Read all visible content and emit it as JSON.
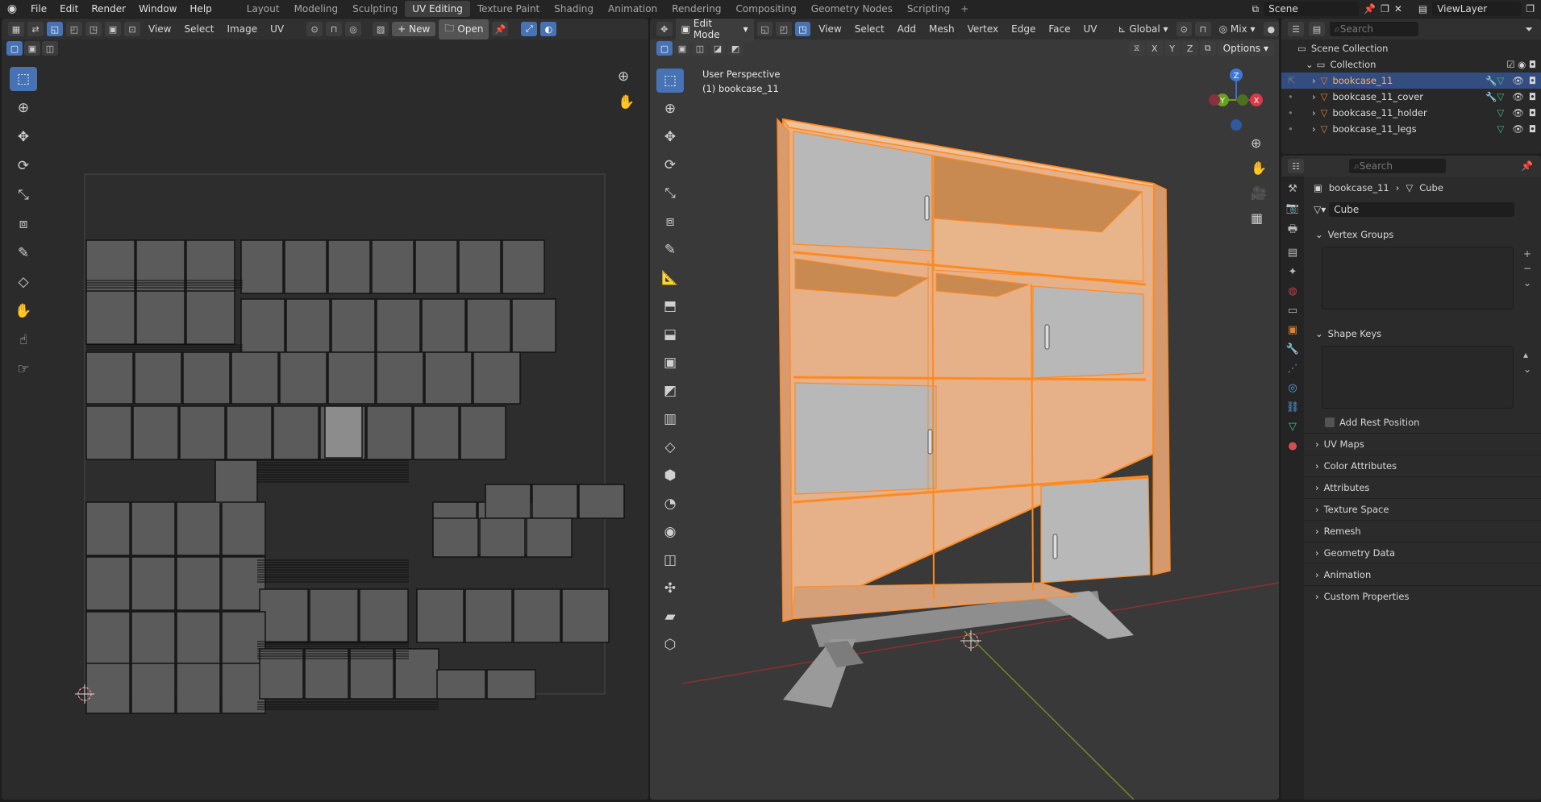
{
  "menubar": {
    "items": [
      "File",
      "Edit",
      "Render",
      "Window",
      "Help"
    ],
    "workspaces": [
      "Layout",
      "Modeling",
      "Sculpting",
      "UV Editing",
      "Texture Paint",
      "Shading",
      "Animation",
      "Rendering",
      "Compositing",
      "Geometry Nodes",
      "Scripting"
    ],
    "active_workspace": "UV Editing",
    "add_tab": "+",
    "scene_label": "Scene",
    "view_layer_label": "ViewLayer"
  },
  "uv_editor": {
    "menus": [
      "View",
      "Select",
      "Image",
      "UV"
    ],
    "new_label": "New",
    "open_label": "Open"
  },
  "viewport": {
    "mode": "Edit Mode",
    "menus": [
      "View",
      "Select",
      "Add",
      "Mesh",
      "Vertex",
      "Edge",
      "Face",
      "UV"
    ],
    "transform_orientation": "Global",
    "shading_mix": "Mix",
    "options_label": "Options",
    "axis_labels": [
      "X",
      "Y",
      "Z"
    ],
    "overlay_title": "User Perspective",
    "overlay_object": "(1) bookcase_11",
    "gizmo": {
      "z": "Z",
      "y": "Y",
      "x": "X"
    }
  },
  "outliner": {
    "search_placeholder": "Search",
    "scene_collection": "Scene Collection",
    "collection": "Collection",
    "objects": [
      {
        "name": "bookcase_11",
        "selected": true
      },
      {
        "name": "bookcase_11_cover",
        "selected": false
      },
      {
        "name": "bookcase_11_holder",
        "selected": false
      },
      {
        "name": "bookcase_11_legs",
        "selected": false
      }
    ]
  },
  "properties": {
    "search_placeholder": "Search",
    "breadcrumb_object": "bookcase_11",
    "breadcrumb_mesh": "Cube",
    "mesh_name": "Cube",
    "vertex_groups": "Vertex Groups",
    "shape_keys": "Shape Keys",
    "add_rest_position": "Add Rest Position",
    "panels": [
      "UV Maps",
      "Color Attributes",
      "Attributes",
      "Texture Space",
      "Remesh",
      "Geometry Data",
      "Animation",
      "Custom Properties"
    ]
  },
  "colors": {
    "accent": "#4772b3",
    "selection_orange": "#ff8a1f",
    "mesh_face": "#e8b48a",
    "door_gray": "#b4b4b4",
    "background": "#1d1d1d",
    "area": "#303030"
  }
}
